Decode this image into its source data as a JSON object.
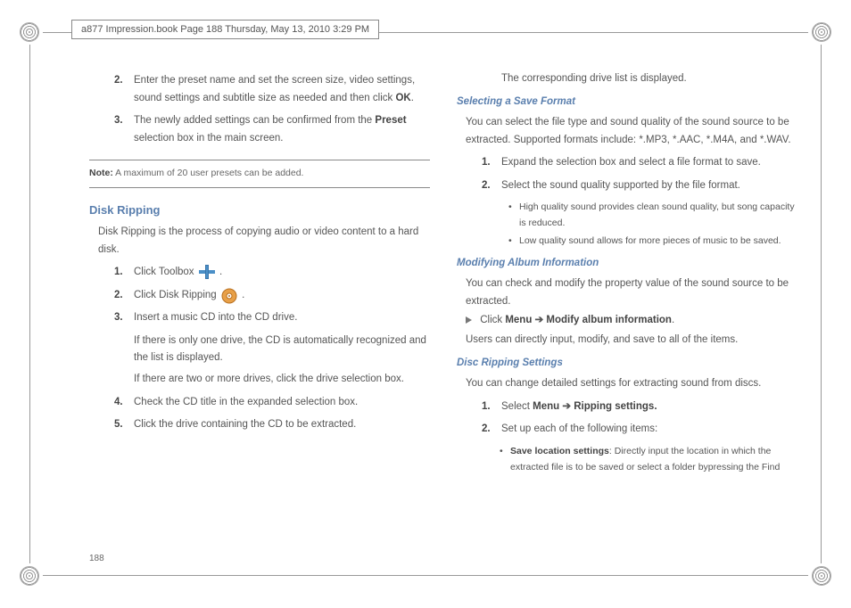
{
  "header": "a877 Impression.book  Page 188  Thursday, May 13, 2010  3:29 PM",
  "pageNumber": "188",
  "left": {
    "item2": {
      "num": "2.",
      "text_a": "Enter the preset name and set the screen size, video settings, sound settings and subtitle size as needed and then click ",
      "bold": "OK",
      "text_b": "."
    },
    "item3": {
      "num": "3.",
      "text_a": "The newly added settings can be confirmed from the ",
      "bold": "Preset",
      "text_b": " selection box in the main screen."
    },
    "note": {
      "label": "Note:",
      "text": " A maximum of 20 user presets can be added."
    },
    "diskRipping": {
      "title": "Disk Ripping",
      "intro": "Disk Ripping is the process of copying audio or video content to a hard disk.",
      "s1": {
        "num": "1.",
        "a": "Click Toolbox ",
        "b": " ."
      },
      "s2": {
        "num": "2.",
        "a": "Click Disk Ripping ",
        "b": " ."
      },
      "s3": {
        "num": "3.",
        "a": "Insert a music CD into the CD drive.",
        "sub1": "If there is only one drive, the CD is automatically recognized and the list is displayed.",
        "sub2": "If there are two or more drives, click the drive selection box."
      },
      "s4": {
        "num": "4.",
        "a": "Check the CD title in the expanded selection box."
      },
      "s5": {
        "num": "5.",
        "a": "Click the drive containing the CD to be extracted."
      }
    }
  },
  "right": {
    "topline": "The corresponding drive list is displayed.",
    "saveFormat": {
      "title": "Selecting a Save Format",
      "intro": "You can select the file type and sound quality of the sound source to be extracted. Supported formats include: *.MP3, *.AAC, *.M4A, and *.WAV.",
      "s1": {
        "num": "1.",
        "a": "Expand the selection box and select a file format to save."
      },
      "s2": {
        "num": "2.",
        "a": "Select the sound quality supported by the file format."
      },
      "b1": "High quality sound provides clean sound quality, but song capacity is reduced.",
      "b2": "Low quality sound allows for more pieces of music to be saved."
    },
    "modAlbum": {
      "title": "Modifying Album Information",
      "intro": "You can check and modify the property value of the sound source to be extracted.",
      "click_a": "Click ",
      "menu": "Menu",
      "arrow": " ➔ ",
      "modify": "Modify album information",
      "dot": ".",
      "after": "Users can directly input, modify, and save to all of the items."
    },
    "ripSettings": {
      "title": "Disc Ripping Settings",
      "intro": "You can change detailed settings for extracting sound from discs.",
      "s1": {
        "num": "1.",
        "a": "Select ",
        "menu": "Menu",
        "arrow": " ➔ ",
        "rip": "Ripping settings."
      },
      "s2": {
        "num": "2.",
        "a": "Set up each of the following items:"
      },
      "b1_label": "Save location settings",
      "b1_text": ": Directly input the location in which the extracted file is to be saved or select a folder bypressing the Find"
    }
  }
}
